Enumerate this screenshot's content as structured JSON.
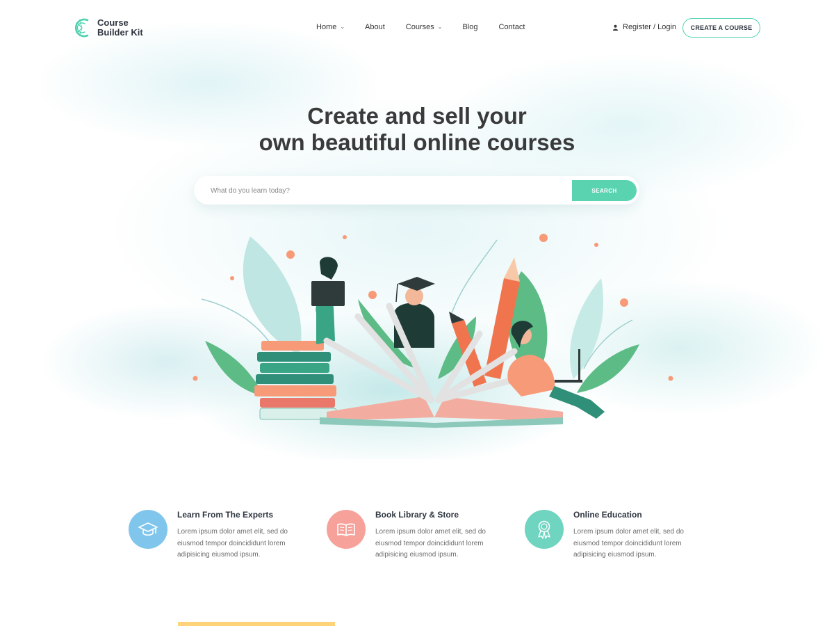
{
  "brand": {
    "line1": "Course",
    "line2": "Builder Kit",
    "accent_color": "#4fd1b0"
  },
  "nav": {
    "items": [
      {
        "label": "Home",
        "has_dropdown": true
      },
      {
        "label": "About",
        "has_dropdown": false
      },
      {
        "label": "Courses",
        "has_dropdown": true
      },
      {
        "label": "Blog",
        "has_dropdown": false
      },
      {
        "label": "Contact",
        "has_dropdown": false
      }
    ],
    "auth_label": "Register / Login",
    "auth_icon": "user-icon",
    "cta_label": "CREATE A COURSE"
  },
  "hero": {
    "title_line1": "Create and sell your",
    "title_line2": "own beautiful online courses",
    "search_placeholder": "What do you learn today?",
    "search_button": "SEARCH",
    "search_button_color": "#5ad3b1"
  },
  "features": [
    {
      "icon": "graduation-cap-icon",
      "icon_bg": "#80c6ec",
      "title": "Learn From The Experts",
      "description": "Lorem ipsum dolor amet elit, sed do eiusmod tempor doincididunt lorem adipisicing eiusmod ipsum."
    },
    {
      "icon": "open-book-icon",
      "icon_bg": "#f6a29b",
      "title": "Book Library & Store",
      "description": "Lorem ipsum dolor amet elit, sed do eiusmod tempor doincididunt lorem adipisicing eiusmod ipsum."
    },
    {
      "icon": "award-badge-icon",
      "icon_bg": "#6fd4c0",
      "title": "Online Education",
      "description": "Lorem ipsum dolor amet elit, sed do eiusmod tempor doincididunt lorem adipisicing eiusmod ipsum."
    }
  ]
}
